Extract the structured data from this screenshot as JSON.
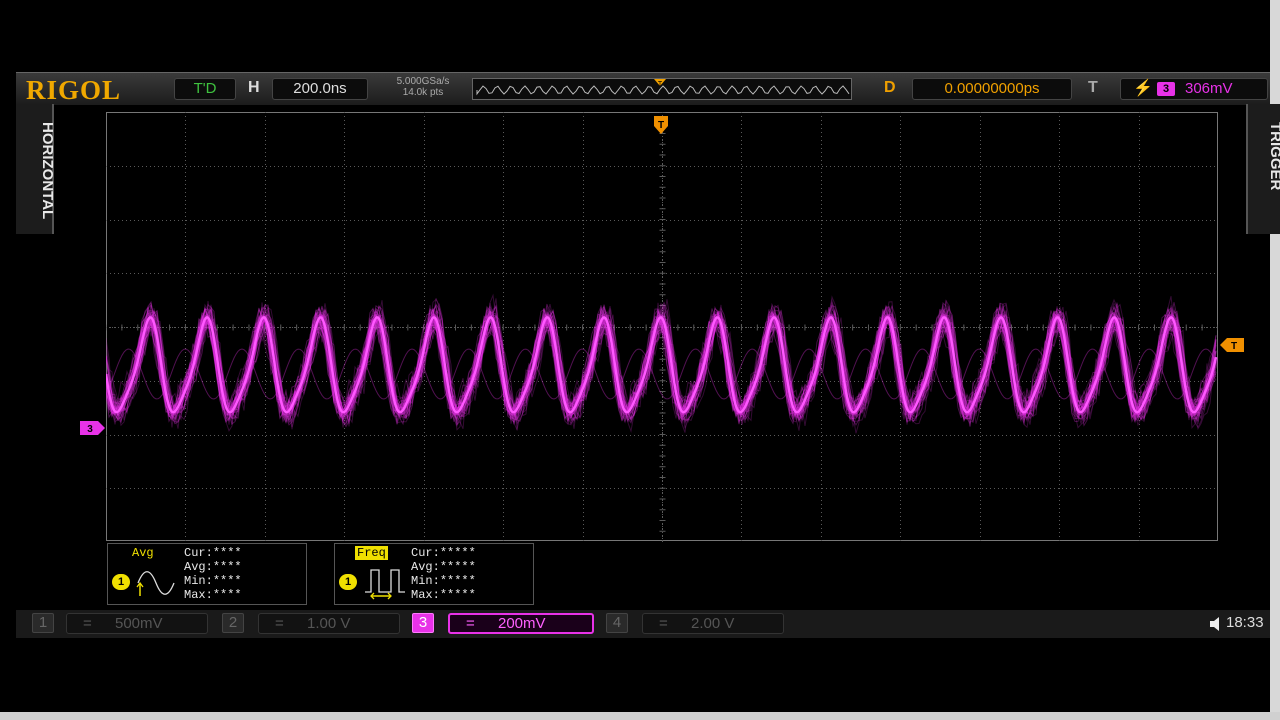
{
  "brand": "RIGOL",
  "status": {
    "run_state": "T'D"
  },
  "horizontal": {
    "label": "H",
    "timebase": "200.0ns",
    "sample_rate": "5.000GSa/s",
    "memory_points": "14.0k pts"
  },
  "delay": {
    "label": "D",
    "value": "0.00000000ps"
  },
  "trigger": {
    "label": "T",
    "source_channel": "3",
    "level": "306mV",
    "edge_icon": "rising-edge-icon"
  },
  "side_tabs": {
    "left": "HORIZONTAL",
    "right": "TRIGGER"
  },
  "markers": {
    "trigger_position": "T",
    "trigger_level": "T",
    "channel_ground": "3"
  },
  "measurements": [
    {
      "title": "Avg",
      "channel": "1",
      "icon": "sine-wave-icon",
      "rows": [
        {
          "k": "Cur:",
          "v": "****"
        },
        {
          "k": "Avg:",
          "v": "****"
        },
        {
          "k": "Min:",
          "v": "****"
        },
        {
          "k": "Max:",
          "v": "****"
        }
      ]
    },
    {
      "title": "Freq",
      "channel": "1",
      "icon": "pulse-wave-icon",
      "rows": [
        {
          "k": "Cur:",
          "v": "*****"
        },
        {
          "k": "Avg:",
          "v": "*****"
        },
        {
          "k": "Min:",
          "v": "*****"
        },
        {
          "k": "Max:",
          "v": "*****"
        }
      ]
    }
  ],
  "channels": [
    {
      "num": "1",
      "coupling": "=",
      "scale": "500mV",
      "active": false
    },
    {
      "num": "2",
      "coupling": "=",
      "scale": "1.00 V",
      "active": false
    },
    {
      "num": "3",
      "coupling": "=",
      "scale": "200mV",
      "active": true
    },
    {
      "num": "4",
      "coupling": "=",
      "scale": "2.00 V",
      "active": false
    }
  ],
  "clock": "18:33",
  "colors": {
    "ch3": "#e832e8",
    "brand": "#f0a800",
    "trigger_marker": "#f09000",
    "grid": "#5a5a5a"
  }
}
